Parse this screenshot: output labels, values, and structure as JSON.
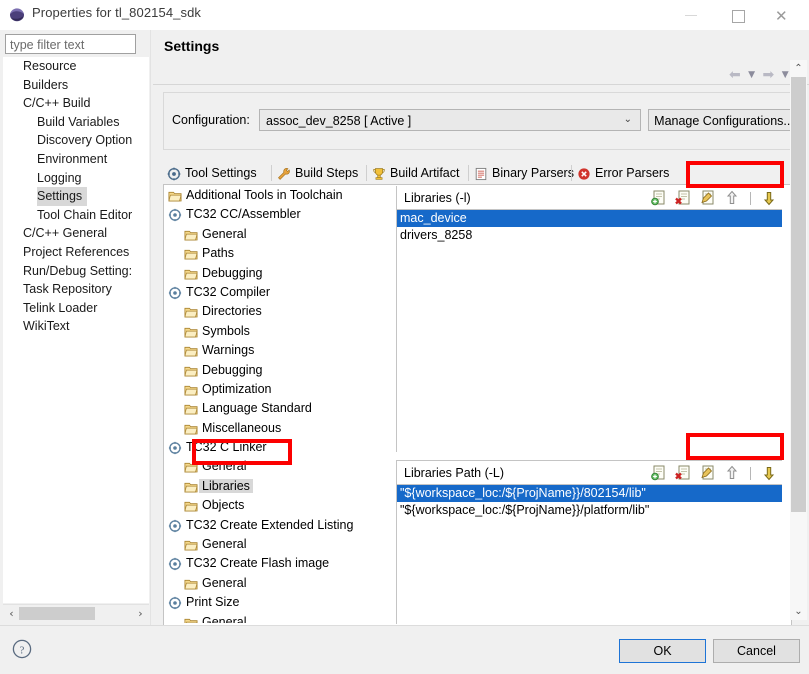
{
  "window": {
    "title": "Properties for tl_802154_sdk",
    "icon": "eclipse-sphere-icon",
    "minimize_label": "–",
    "maximize_label": "□",
    "close_label": "✕"
  },
  "filter": {
    "placeholder": "type filter text",
    "value": "type filter text"
  },
  "sidebar": {
    "items": [
      {
        "label": "Resource",
        "indent": 0,
        "selected": false
      },
      {
        "label": "Builders",
        "indent": 0,
        "selected": false
      },
      {
        "label": "C/C++ Build",
        "indent": 0,
        "selected": false
      },
      {
        "label": "Build Variables",
        "indent": 1,
        "selected": false
      },
      {
        "label": "Discovery Option",
        "indent": 1,
        "selected": false
      },
      {
        "label": "Environment",
        "indent": 1,
        "selected": false
      },
      {
        "label": "Logging",
        "indent": 1,
        "selected": false
      },
      {
        "label": "Settings",
        "indent": 1,
        "selected": true
      },
      {
        "label": "Tool Chain Editor",
        "indent": 1,
        "selected": false
      },
      {
        "label": "C/C++ General",
        "indent": 0,
        "selected": false
      },
      {
        "label": "Project References",
        "indent": 0,
        "selected": false
      },
      {
        "label": "Run/Debug Setting:",
        "indent": 0,
        "selected": false
      },
      {
        "label": "Task Repository",
        "indent": 0,
        "selected": false
      },
      {
        "label": "Telink Loader",
        "indent": 0,
        "selected": false
      },
      {
        "label": "WikiText",
        "indent": 0,
        "selected": false
      }
    ],
    "scroll_left_label": "‹",
    "scroll_right_label": "›"
  },
  "page": {
    "title": "Settings",
    "nav": {
      "back_label": "⬅",
      "back_menu_label": "▼",
      "forward_label": "➡",
      "forward_menu_label": "▼",
      "view_menu_label": "▼"
    }
  },
  "configuration": {
    "label": "Configuration:",
    "value": "assoc_dev_8258  [ Active ]",
    "caret": "⌄",
    "manage_button": "Manage Configurations..."
  },
  "tabs": [
    {
      "label": "Tool Settings",
      "icon": "tool-settings-icon",
      "active": true
    },
    {
      "label": "Build Steps",
      "icon": "wrench-icon",
      "active": false
    },
    {
      "label": "Build Artifact",
      "icon": "trophy-icon",
      "active": false
    },
    {
      "label": "Binary Parsers",
      "icon": "binary-parser-icon",
      "active": false
    },
    {
      "label": "Error Parsers",
      "icon": "error-icon",
      "active": false
    }
  ],
  "tool_tree": [
    {
      "label": "Additional Tools in Toolchain",
      "level": 0,
      "icon": "folder-icon",
      "selected": false
    },
    {
      "label": "TC32 CC/Assembler",
      "level": 0,
      "icon": "tool-icon",
      "selected": false
    },
    {
      "label": "General",
      "level": 1,
      "icon": "folder-icon",
      "selected": false
    },
    {
      "label": "Paths",
      "level": 1,
      "icon": "folder-icon",
      "selected": false
    },
    {
      "label": "Debugging",
      "level": 1,
      "icon": "folder-icon",
      "selected": false
    },
    {
      "label": "TC32 Compiler",
      "level": 0,
      "icon": "tool-icon",
      "selected": false
    },
    {
      "label": "Directories",
      "level": 1,
      "icon": "folder-icon",
      "selected": false
    },
    {
      "label": "Symbols",
      "level": 1,
      "icon": "folder-icon",
      "selected": false
    },
    {
      "label": "Warnings",
      "level": 1,
      "icon": "folder-icon",
      "selected": false
    },
    {
      "label": "Debugging",
      "level": 1,
      "icon": "folder-icon",
      "selected": false
    },
    {
      "label": "Optimization",
      "level": 1,
      "icon": "folder-icon",
      "selected": false
    },
    {
      "label": "Language Standard",
      "level": 1,
      "icon": "folder-icon",
      "selected": false
    },
    {
      "label": "Miscellaneous",
      "level": 1,
      "icon": "folder-icon",
      "selected": false
    },
    {
      "label": "TC32 C Linker",
      "level": 0,
      "icon": "tool-icon",
      "selected": false
    },
    {
      "label": "General",
      "level": 1,
      "icon": "folder-icon",
      "selected": false
    },
    {
      "label": "Libraries",
      "level": 1,
      "icon": "folder-icon",
      "selected": true
    },
    {
      "label": "Objects",
      "level": 1,
      "icon": "folder-icon",
      "selected": false
    },
    {
      "label": "TC32 Create Extended Listing",
      "level": 0,
      "icon": "tool-icon",
      "selected": false
    },
    {
      "label": "General",
      "level": 1,
      "icon": "folder-icon",
      "selected": false
    },
    {
      "label": "TC32 Create Flash image",
      "level": 0,
      "icon": "tool-icon",
      "selected": false
    },
    {
      "label": "General",
      "level": 1,
      "icon": "folder-icon",
      "selected": false
    },
    {
      "label": "Print Size",
      "level": 0,
      "icon": "tool-icon",
      "selected": false
    },
    {
      "label": "General",
      "level": 1,
      "icon": "folder-icon",
      "selected": false
    }
  ],
  "libraries_panel": {
    "header": "Libraries (-l)",
    "toolbar": [
      {
        "name": "add-icon",
        "title": "Add"
      },
      {
        "name": "delete-icon",
        "title": "Delete"
      },
      {
        "name": "edit-icon",
        "title": "Edit"
      },
      {
        "name": "move-up-icon",
        "title": "Move Up"
      },
      {
        "name": "move-down-icon",
        "title": "Move Down"
      }
    ],
    "rows": [
      {
        "value": "mac_device",
        "selected": true
      },
      {
        "value": "drivers_8258",
        "selected": false
      }
    ]
  },
  "libraries_path_panel": {
    "header": "Libraries Path (-L)",
    "toolbar": [
      {
        "name": "add-icon",
        "title": "Add"
      },
      {
        "name": "delete-icon",
        "title": "Delete"
      },
      {
        "name": "edit-icon",
        "title": "Edit"
      },
      {
        "name": "move-up-icon",
        "title": "Move Up"
      },
      {
        "name": "move-down-icon",
        "title": "Move Down"
      }
    ],
    "rows": [
      {
        "value": "\"${workspace_loc:/${ProjName}}/802154/lib\"",
        "selected": true
      },
      {
        "value": "\"${workspace_loc:/${ProjName}}/platform/lib\"",
        "selected": false
      }
    ]
  },
  "scrollbars": {
    "left_arrow": "‹",
    "right_arrow": "›",
    "up_arrow": "⌃",
    "down_arrow": "⌄"
  },
  "footer": {
    "help_label": "?",
    "ok_label": "OK",
    "cancel_label": "Cancel"
  },
  "annotations": {
    "color": "#fc0000",
    "boxes": [
      {
        "name": "libraries-toolbar-highlight"
      },
      {
        "name": "libraries-path-toolbar-highlight"
      },
      {
        "name": "libraries-tree-item-highlight"
      }
    ]
  }
}
